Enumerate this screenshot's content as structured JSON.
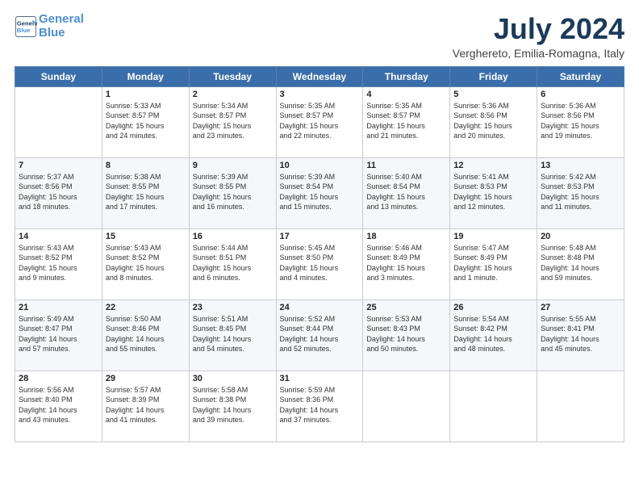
{
  "logo": {
    "line1": "General",
    "line2": "Blue"
  },
  "title": "July 2024",
  "location": "Verghereto, Emilia-Romagna, Italy",
  "weekdays": [
    "Sunday",
    "Monday",
    "Tuesday",
    "Wednesday",
    "Thursday",
    "Friday",
    "Saturday"
  ],
  "weeks": [
    [
      {
        "day": "",
        "info": ""
      },
      {
        "day": "1",
        "info": "Sunrise: 5:33 AM\nSunset: 8:57 PM\nDaylight: 15 hours\nand 24 minutes."
      },
      {
        "day": "2",
        "info": "Sunrise: 5:34 AM\nSunset: 8:57 PM\nDaylight: 15 hours\nand 23 minutes."
      },
      {
        "day": "3",
        "info": "Sunrise: 5:35 AM\nSunset: 8:57 PM\nDaylight: 15 hours\nand 22 minutes."
      },
      {
        "day": "4",
        "info": "Sunrise: 5:35 AM\nSunset: 8:57 PM\nDaylight: 15 hours\nand 21 minutes."
      },
      {
        "day": "5",
        "info": "Sunrise: 5:36 AM\nSunset: 8:56 PM\nDaylight: 15 hours\nand 20 minutes."
      },
      {
        "day": "6",
        "info": "Sunrise: 5:36 AM\nSunset: 8:56 PM\nDaylight: 15 hours\nand 19 minutes."
      }
    ],
    [
      {
        "day": "7",
        "info": "Sunrise: 5:37 AM\nSunset: 8:56 PM\nDaylight: 15 hours\nand 18 minutes."
      },
      {
        "day": "8",
        "info": "Sunrise: 5:38 AM\nSunset: 8:55 PM\nDaylight: 15 hours\nand 17 minutes."
      },
      {
        "day": "9",
        "info": "Sunrise: 5:39 AM\nSunset: 8:55 PM\nDaylight: 15 hours\nand 16 minutes."
      },
      {
        "day": "10",
        "info": "Sunrise: 5:39 AM\nSunset: 8:54 PM\nDaylight: 15 hours\nand 15 minutes."
      },
      {
        "day": "11",
        "info": "Sunrise: 5:40 AM\nSunset: 8:54 PM\nDaylight: 15 hours\nand 13 minutes."
      },
      {
        "day": "12",
        "info": "Sunrise: 5:41 AM\nSunset: 8:53 PM\nDaylight: 15 hours\nand 12 minutes."
      },
      {
        "day": "13",
        "info": "Sunrise: 5:42 AM\nSunset: 8:53 PM\nDaylight: 15 hours\nand 11 minutes."
      }
    ],
    [
      {
        "day": "14",
        "info": "Sunrise: 5:43 AM\nSunset: 8:52 PM\nDaylight: 15 hours\nand 9 minutes."
      },
      {
        "day": "15",
        "info": "Sunrise: 5:43 AM\nSunset: 8:52 PM\nDaylight: 15 hours\nand 8 minutes."
      },
      {
        "day": "16",
        "info": "Sunrise: 5:44 AM\nSunset: 8:51 PM\nDaylight: 15 hours\nand 6 minutes."
      },
      {
        "day": "17",
        "info": "Sunrise: 5:45 AM\nSunset: 8:50 PM\nDaylight: 15 hours\nand 4 minutes."
      },
      {
        "day": "18",
        "info": "Sunrise: 5:46 AM\nSunset: 8:49 PM\nDaylight: 15 hours\nand 3 minutes."
      },
      {
        "day": "19",
        "info": "Sunrise: 5:47 AM\nSunset: 8:49 PM\nDaylight: 15 hours\nand 1 minute."
      },
      {
        "day": "20",
        "info": "Sunrise: 5:48 AM\nSunset: 8:48 PM\nDaylight: 14 hours\nand 59 minutes."
      }
    ],
    [
      {
        "day": "21",
        "info": "Sunrise: 5:49 AM\nSunset: 8:47 PM\nDaylight: 14 hours\nand 57 minutes."
      },
      {
        "day": "22",
        "info": "Sunrise: 5:50 AM\nSunset: 8:46 PM\nDaylight: 14 hours\nand 55 minutes."
      },
      {
        "day": "23",
        "info": "Sunrise: 5:51 AM\nSunset: 8:45 PM\nDaylight: 14 hours\nand 54 minutes."
      },
      {
        "day": "24",
        "info": "Sunrise: 5:52 AM\nSunset: 8:44 PM\nDaylight: 14 hours\nand 52 minutes."
      },
      {
        "day": "25",
        "info": "Sunrise: 5:53 AM\nSunset: 8:43 PM\nDaylight: 14 hours\nand 50 minutes."
      },
      {
        "day": "26",
        "info": "Sunrise: 5:54 AM\nSunset: 8:42 PM\nDaylight: 14 hours\nand 48 minutes."
      },
      {
        "day": "27",
        "info": "Sunrise: 5:55 AM\nSunset: 8:41 PM\nDaylight: 14 hours\nand 45 minutes."
      }
    ],
    [
      {
        "day": "28",
        "info": "Sunrise: 5:56 AM\nSunset: 8:40 PM\nDaylight: 14 hours\nand 43 minutes."
      },
      {
        "day": "29",
        "info": "Sunrise: 5:57 AM\nSunset: 8:39 PM\nDaylight: 14 hours\nand 41 minutes."
      },
      {
        "day": "30",
        "info": "Sunrise: 5:58 AM\nSunset: 8:38 PM\nDaylight: 14 hours\nand 39 minutes."
      },
      {
        "day": "31",
        "info": "Sunrise: 5:59 AM\nSunset: 8:36 PM\nDaylight: 14 hours\nand 37 minutes."
      },
      {
        "day": "",
        "info": ""
      },
      {
        "day": "",
        "info": ""
      },
      {
        "day": "",
        "info": ""
      }
    ]
  ]
}
